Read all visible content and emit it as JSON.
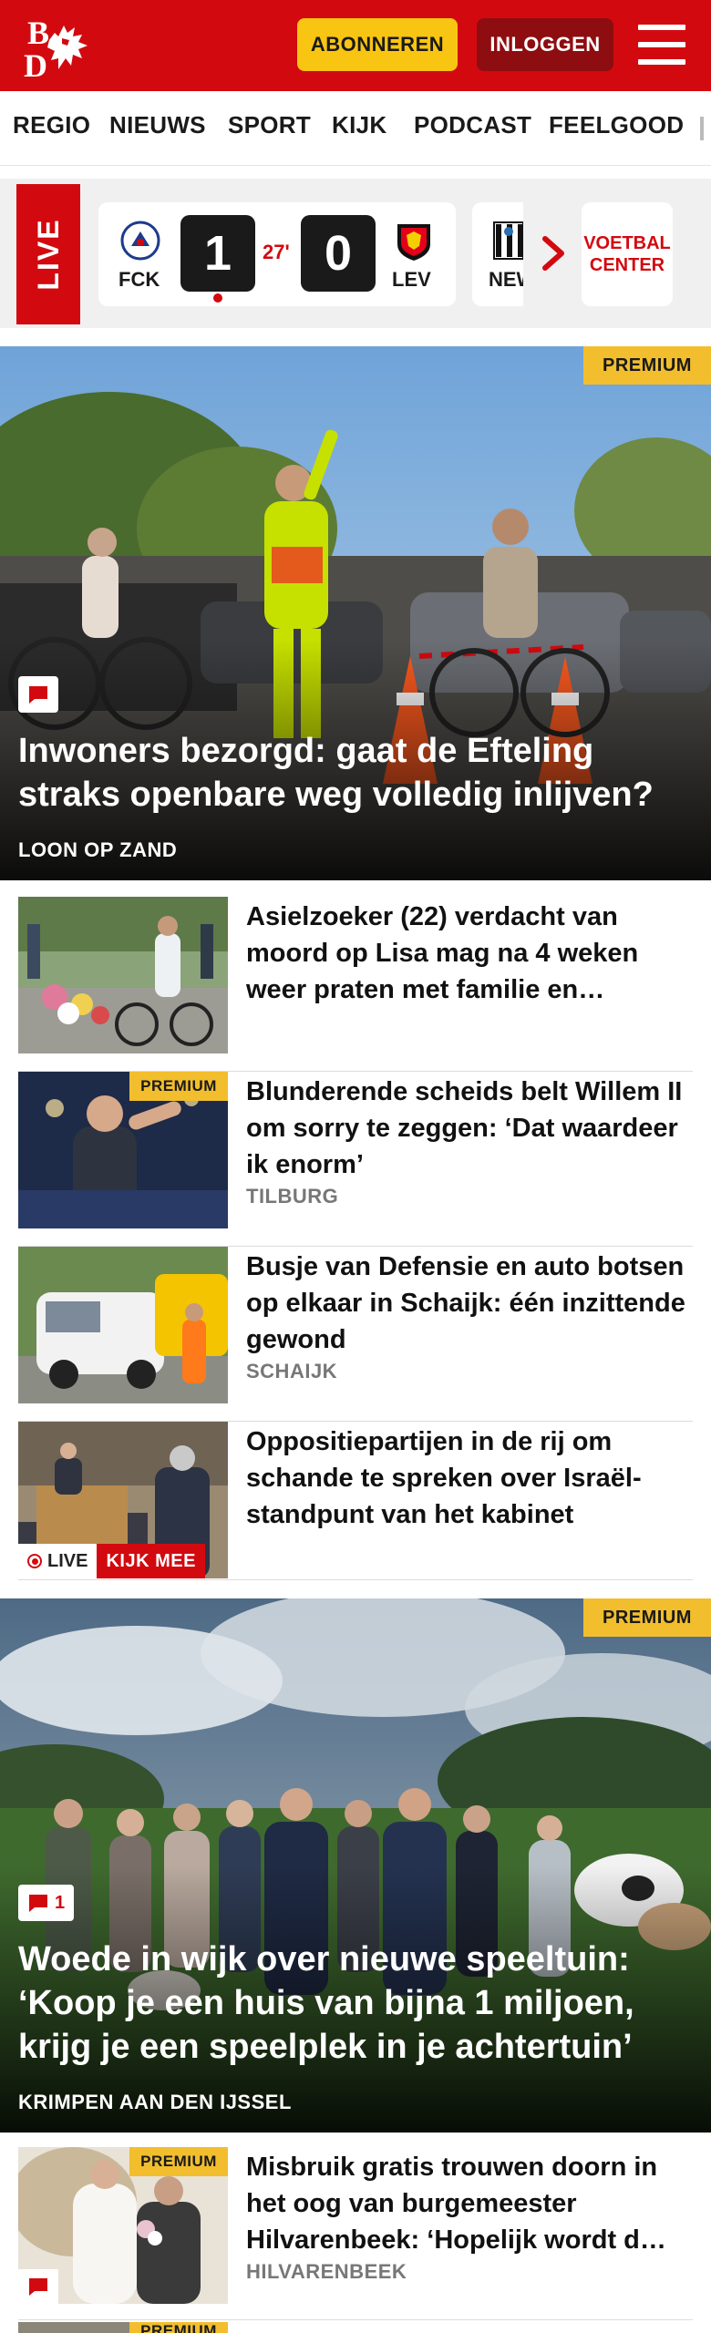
{
  "header": {
    "logo_alt": "BD",
    "subscribe_label": "ABONNEREN",
    "login_label": "INLOGGEN"
  },
  "nav": {
    "items": [
      "REGIO",
      "NIEUWS",
      "SPORT",
      "KIJK",
      "PODCAST",
      "FEELGOOD"
    ]
  },
  "live": {
    "tag": "LIVE",
    "match": {
      "home_abbr": "FCK",
      "away_abbr": "LEV",
      "home_score": "1",
      "away_score": "0",
      "minute": "27'"
    },
    "next_match_abbr": "NEW",
    "voetbal_center_label": "VOETBAL CENTER"
  },
  "hero1": {
    "premium": "PREMIUM",
    "title": "Inwoners bezorgd: gaat de Efteling straks openbare weg volledig inlijven?",
    "location": "LOON OP ZAND"
  },
  "articles": [
    {
      "title": "Asielzoeker (22) verdacht van moord op Lisa mag na 4 weken weer praten met familie en…",
      "location": ""
    },
    {
      "premium": "PREMIUM",
      "title": "Blunderende scheids belt Willem II om sorry te zeggen: ‘Dat waardeer ik enorm’",
      "location": "TILBURG"
    },
    {
      "title": "Busje van Defensie en auto botsen op elkaar in Schaijk: één inzittende gewond",
      "location": "SCHAIJK"
    },
    {
      "title": "Oppositiepartijen in de rij om schande te spreken over Israël-standpunt van het kabinet",
      "location": "",
      "live_label": "LIVE",
      "watch_label": "KIJK MEE"
    }
  ],
  "hero2": {
    "premium": "PREMIUM",
    "comment_count": "1",
    "title": "Woede in wijk over nieuwe speeltuin: ‘Koop je een huis van bijna 1 miljoen, krijg je een speelplek in je achtertuin’",
    "location": "KRIMPEN AAN DEN IJSSEL"
  },
  "articles2": [
    {
      "premium": "PREMIUM",
      "title": "Misbruik gratis trouwen doorn in het oog van burgemeester Hilvarenbeek: ‘Hopelijk wordt d…",
      "location": "HILVARENBEEK"
    },
    {
      "premium": "PREMIUM"
    }
  ],
  "colors": {
    "brand_red": "#d20a0f",
    "premium_yellow": "#f2be2e",
    "subscribe_yellow": "#f9c513",
    "login_dark_red": "#8e0d10"
  }
}
